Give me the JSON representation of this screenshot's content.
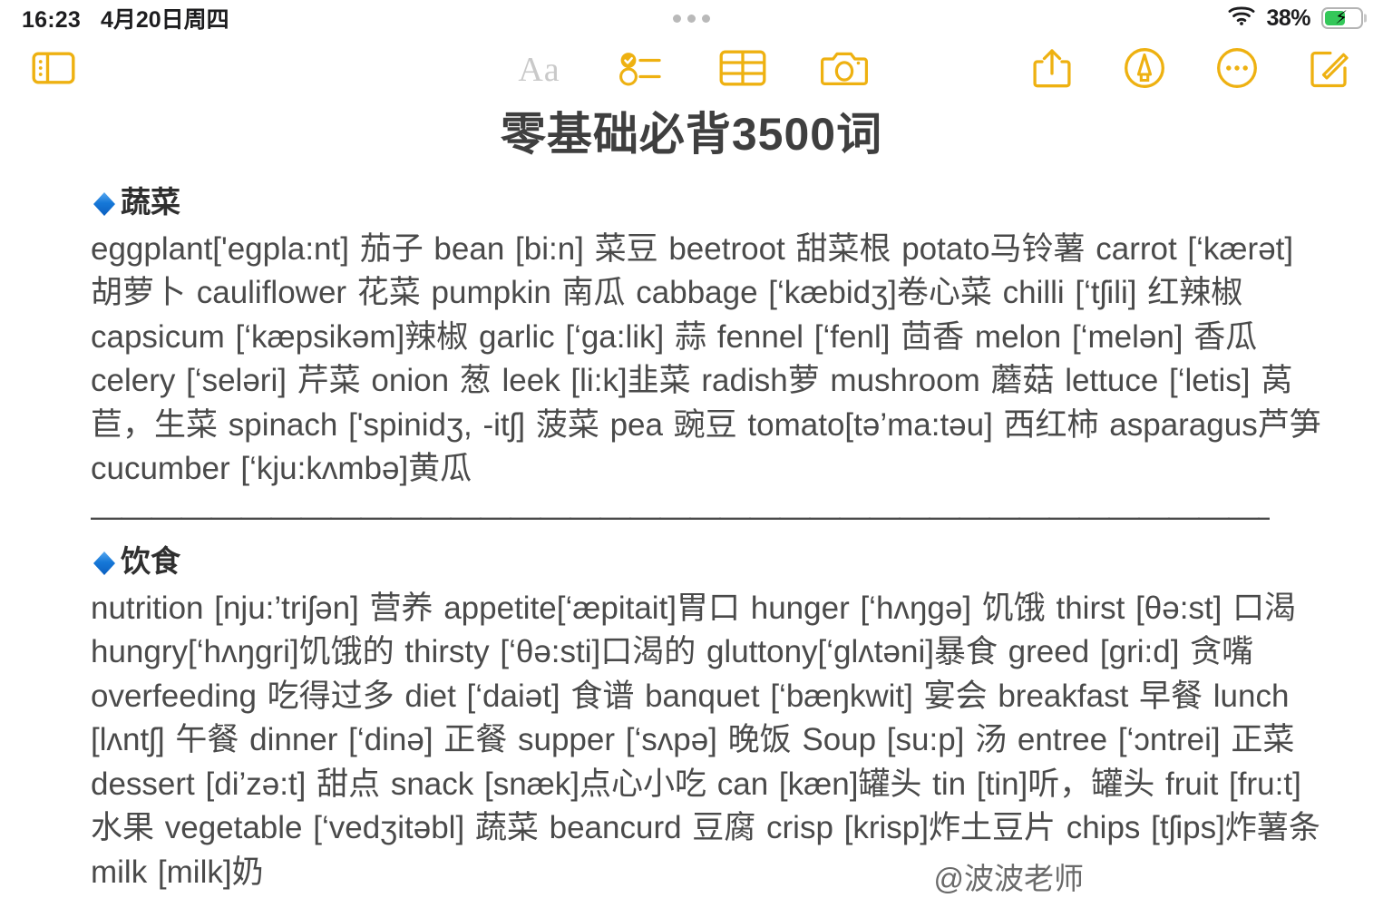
{
  "status_bar": {
    "time": "16:23",
    "date": "4月20日周四",
    "battery_percent": "38%",
    "wifi_icon": "wifi-icon",
    "battery_icon": "battery-charging-icon",
    "more_dots_icon": "multitasking-dots-icon"
  },
  "toolbar": {
    "sidebar_toggle_label": "sidebar-toggle",
    "format_label": "Aa",
    "checklist_label": "checklist",
    "table_label": "table",
    "camera_label": "camera",
    "share_label": "share",
    "markup_label": "markup",
    "more_label": "more",
    "compose_label": "compose"
  },
  "document": {
    "title": "零基础必背3500词",
    "sections": [
      {
        "bullet": "🔷",
        "heading": "蔬菜",
        "body": "eggplant['egpla:nt] 茄子  bean [bi:n] 菜豆   beetroot 甜菜根  potato马铃薯  carrot [‘kærət] 胡萝卜  cauliflower 花菜   pumpkin 南瓜   cabbage [‘kæbidʒ]卷心菜  chilli [‘tʃili] 红辣椒   capsicum [‘kæpsikəm]辣椒   garlic [‘ga:lik] 蒜   fennel [‘fenl] 茴香  melon [‘melən] 香瓜  celery [‘seləri] 芹菜  onion 葱  leek [li:k]韭菜  radish萝 mushroom 蘑菇  lettuce [‘letis] 莴苣，生菜  spinach ['spinidʒ, -itʃ] 菠菜  pea 豌豆  tomato[tə’ma:təu] 西红柿  asparagus芦笋  cucumber [‘kju:kʌmbə]黄瓜"
      }
    ],
    "divider": "—————————————————————————————————————————",
    "section2": {
      "bullet": "🔷",
      "heading": "饮食",
      "body": "nutrition [nju:’triʃən] 营养  appetite[‘æpitait]胃口  hunger [‘hʌŋgə] 饥饿  thirst [θə:st] 口渴  hungry[‘hʌŋgri]饥饿的  thirsty [‘θə:sti]口渴的  gluttony[‘glʌtəni]暴食  greed [gri:d] 贪嘴  overfeeding 吃得过多  diet [‘daiət] 食谱  banquet [‘bæŋkwit] 宴会  breakfast 早餐  lunch [lʌntʃ] 午餐  dinner [‘dinə] 正餐  supper [‘sʌpə] 晚饭  Soup [su:p] 汤  entree [‘ɔntrei] 正菜  dessert [di’zə:t] 甜点  snack [snæk]点心小吃  can [kæn]罐头 tin [tin]听，罐头  fruit [fru:t]水果  vegetable [‘vedʒitəbl] 蔬菜  beancurd 豆腐  crisp [krisp]炸土豆片 chips [tʃips]炸薯条  milk [milk]奶"
    },
    "watermark": "@波波老师"
  },
  "colors": {
    "accent": "#eeb111",
    "text": "#4a4a4a",
    "title": "#3f3f3f",
    "battery_green": "#34c759",
    "diamond_blue": "#1e7fe0"
  }
}
